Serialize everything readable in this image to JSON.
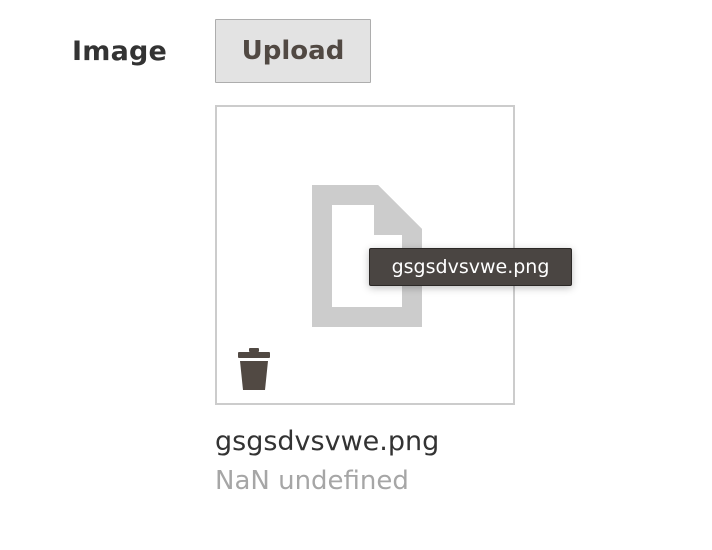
{
  "field": {
    "label": "Image"
  },
  "upload": {
    "button_label": "Upload"
  },
  "file": {
    "name": "gsgsdvsvwe.png",
    "size_text": "NaN undefined",
    "tooltip": "gsgsdvsvwe.png",
    "preview_icon": "file-icon",
    "delete_icon": "trash-icon"
  },
  "colors": {
    "label_text": "#333333",
    "button_bg": "#e3e3e3",
    "button_border": "#adadad",
    "button_text": "#514943",
    "preview_border": "#cccccc",
    "file_icon": "#cccccc",
    "trash_icon": "#514943",
    "tooltip_bg": "#4a4542",
    "muted_text": "#a6a6a6"
  }
}
